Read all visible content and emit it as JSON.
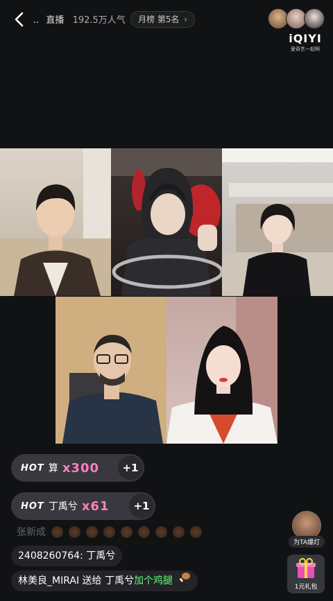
{
  "header": {
    "dots": "..",
    "live_label": "直播",
    "popularity": "192.5万人气",
    "rank": "月榜 第5名",
    "logo": "iQIYI",
    "slogan": "爱奇艺一起啊"
  },
  "hot_combos": [
    {
      "tag": "HOT",
      "name": "算",
      "count": "x300",
      "plus": "+1"
    },
    {
      "tag": "HOT",
      "name": "丁禹兮",
      "count": "x61",
      "plus": "+1"
    }
  ],
  "chat": {
    "faded_name": "张新成",
    "line1": "2408260764: 丁禹兮",
    "line2_user": "林美良_MIRAI",
    "line2_action": "送给",
    "line2_target": "丁禹兮",
    "line2_gift": "加个鸡腿"
  },
  "right_buttons": {
    "spotlight": "为TA爆灯",
    "gift_pack": "1元礼包"
  },
  "colors": {
    "background": "#101214",
    "combo_count": "#ff7fbf",
    "gift_text": "#5cff7a"
  }
}
